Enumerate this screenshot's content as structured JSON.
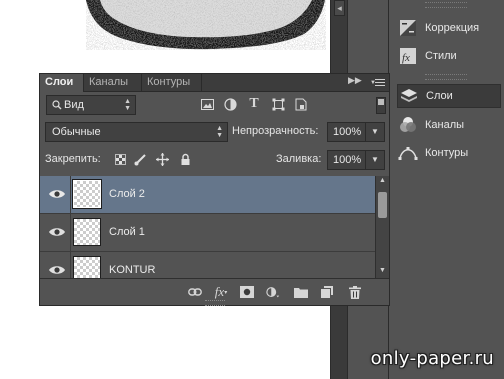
{
  "panel": {
    "tabs": [
      {
        "label": "Слои",
        "active": true
      },
      {
        "label": "Каналы",
        "active": false
      },
      {
        "label": "Контуры",
        "active": false
      }
    ],
    "filter": {
      "value": "Вид",
      "icon": "search-icon"
    },
    "filter_icons": [
      "image-filter-icon",
      "adjustment-filter-icon",
      "type-filter-icon",
      "shape-filter-icon",
      "smart-object-filter-icon"
    ],
    "blend_mode": "Обычные",
    "opacity_label": "Непрозрачность:",
    "opacity_value": "100%",
    "lock_label": "Закрепить:",
    "lock_icons": [
      "lock-transparency-icon",
      "lock-pixels-icon",
      "lock-position-icon",
      "lock-all-icon"
    ],
    "fill_label": "Заливка:",
    "fill_value": "100%",
    "layers": [
      {
        "name": "Слой 2",
        "selected": true,
        "visible": true
      },
      {
        "name": "Слой 1",
        "selected": false,
        "visible": true
      },
      {
        "name": "KONTUR",
        "selected": false,
        "visible": true
      }
    ],
    "footer_icons": [
      "link-layers-icon",
      "fx-icon",
      "add-mask-icon",
      "adjustment-layer-icon",
      "new-group-icon",
      "new-layer-icon",
      "trash-icon"
    ],
    "footer_fx_label": "fx"
  },
  "dock": {
    "items": [
      {
        "label": "Коррекция",
        "icon": "adjustments-icon",
        "active": false
      },
      {
        "label": "Стили",
        "icon": "styles-icon",
        "active": false
      },
      {
        "label": "Слои",
        "icon": "layers-icon",
        "active": true
      },
      {
        "label": "Каналы",
        "icon": "channels-icon",
        "active": false
      },
      {
        "label": "Контуры",
        "icon": "paths-icon",
        "active": false
      }
    ]
  },
  "watermark": "only-paper.ru",
  "colors": {
    "panel_bg": "#535353",
    "selected_row": "#65768b",
    "tabbar_bg": "#3c3c3c"
  }
}
